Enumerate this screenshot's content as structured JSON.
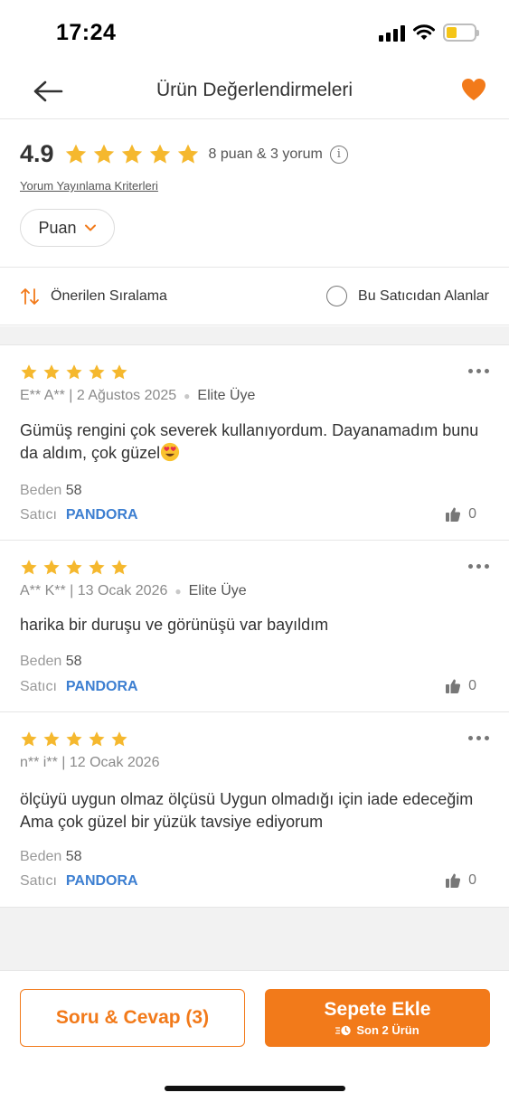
{
  "status_bar": {
    "time": "17:24"
  },
  "header": {
    "title": "Ürün Değerlendirmeleri"
  },
  "summary": {
    "score": "4.9",
    "rating_stars": 5,
    "counts": "8 puan & 3 yorum",
    "info_symbol": "i",
    "criteria_link": "Yorum Yayınlama Kriterleri",
    "filter_label": "Puan"
  },
  "sort": {
    "sort_label": "Önerilen Sıralama",
    "seller_filter_label": "Bu Satıcıdan Alanlar"
  },
  "reviews": [
    {
      "stars": 5,
      "author_date": "E** A** | 2 Ağustos 2025",
      "badge": "Elite Üye",
      "comment": "Gümüş rengini çok severek kullanıyordum. Dayanamadım bunu da aldım, çok güzel",
      "has_emoji": true,
      "size_label": "Beden",
      "size_value": "58",
      "seller_label": "Satıcı",
      "seller_name": "PANDORA",
      "likes": "0"
    },
    {
      "stars": 5,
      "author_date": "A** K** | 13 Ocak 2026",
      "badge": "Elite Üye",
      "comment": "harika bir duruşu ve görünüşü var bayıldım",
      "has_emoji": false,
      "size_label": "Beden",
      "size_value": "58",
      "seller_label": "Satıcı",
      "seller_name": "PANDORA",
      "likes": "0"
    },
    {
      "stars": 5,
      "author_date": "n** i** | 12 Ocak 2026",
      "badge": "",
      "comment": "ölçüyü uygun olmaz ölçüsü Uygun olmadığı için iade edeceğim Ama çok güzel bir yüzük tavsiye ediyorum",
      "has_emoji": false,
      "size_label": "Beden",
      "size_value": "58",
      "seller_label": "Satıcı",
      "seller_name": "PANDORA",
      "likes": "0"
    }
  ],
  "bottom_bar": {
    "qa_button": "Soru & Cevap (3)",
    "cart_button": "Sepete Ekle",
    "cart_sub": "Son 2 Ürün"
  },
  "colors": {
    "accent": "#f27a1a",
    "star": "#f5b82e",
    "seller_link": "#3d7fd1"
  },
  "icons": [
    "back-arrow-icon",
    "heart-icon",
    "star-icon",
    "info-icon",
    "chevron-down-icon",
    "sort-icon",
    "radio-icon",
    "more-icon",
    "thumbs-up-icon",
    "clock-icon",
    "signal-icon",
    "wifi-icon",
    "battery-icon"
  ]
}
